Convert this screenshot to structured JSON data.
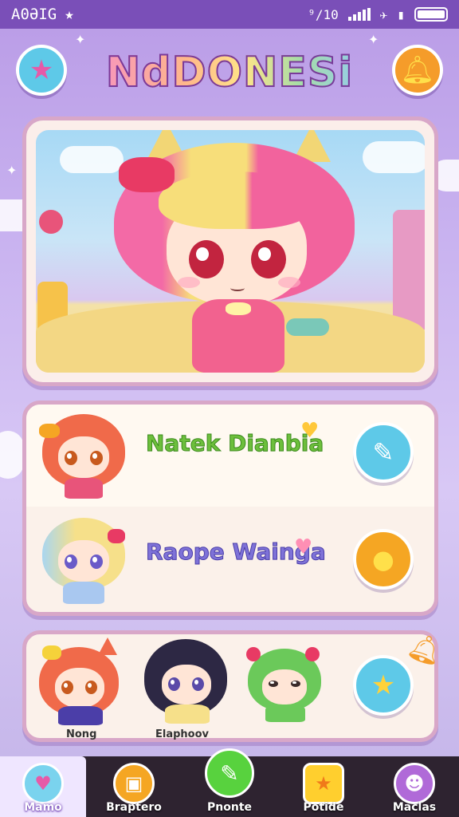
{
  "status_bar": {
    "left_text": "A0ƏIG",
    "left_icon": "star-icon",
    "time": "⁹/10",
    "icons": [
      "signal-icon",
      "wifi-icon",
      "battery-icon"
    ]
  },
  "header": {
    "title": "NdDONESi",
    "left_button_icon": "star-icon",
    "right_button_icon": "bell-icon"
  },
  "hero": {
    "character": "chibi-girl-pink-blonde"
  },
  "player_list": [
    {
      "name": "Natek Dianbia",
      "heart_icon": "heart-icon",
      "action_icon": "chat-icon",
      "action_color": "#5ec9e8"
    },
    {
      "name": "Raope Wainga",
      "heart_icon": "heart-icon",
      "action_icon": "chat-icon",
      "action_color": "#f5a623"
    }
  ],
  "friends": [
    {
      "label": "Nong"
    },
    {
      "label": "Elaphoov"
    },
    {
      "label": ""
    }
  ],
  "friends_action_icon": "star-chat-icon",
  "bottom_nav": [
    {
      "label": "Mamo",
      "icon": "home-icon",
      "active": true,
      "color": "#7ad3ee"
    },
    {
      "label": "Braptero",
      "icon": "bag-icon",
      "active": false,
      "color": "#f5a623"
    },
    {
      "label": "Pnonte",
      "icon": "chat-icon",
      "active": false,
      "color": "#58d23e"
    },
    {
      "label": "Potide",
      "icon": "star-icon",
      "active": false,
      "color": "#ffcf2e"
    },
    {
      "label": "Maclas",
      "icon": "user-icon",
      "active": false,
      "color": "#b06ad8"
    }
  ],
  "colors": {
    "status_bar": "#7a4fb8",
    "card_border": "#d8a7c8",
    "nav_bg": "#2e2330"
  }
}
